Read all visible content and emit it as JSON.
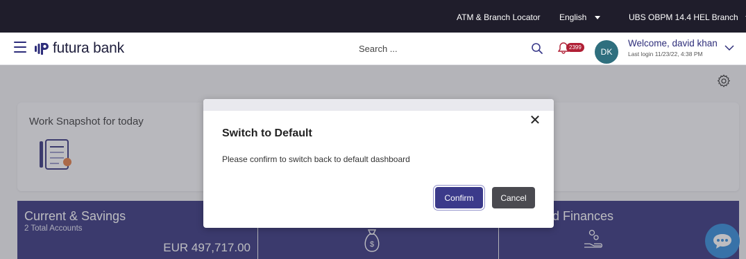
{
  "topbar": {
    "atm_locator": "ATM & Branch Locator",
    "language": "English",
    "branch": "UBS OBPM 14.4 HEL Branch"
  },
  "header": {
    "brand": "futura bank",
    "search_placeholder": "Search ...",
    "notification_count": "2399",
    "avatar_initials": "DK",
    "welcome": "Welcome, david khan",
    "last_login": "Last login 11/23/22, 4:38 PM"
  },
  "dashboard": {
    "snapshot_title": "Work Snapshot for today",
    "current_savings": {
      "title": "Current & Savings",
      "subtitle": "2 Total Accounts",
      "amount": "EUR 497,717.00"
    },
    "finances_title": "d Finances"
  },
  "modal": {
    "title": "Switch to Default",
    "message": "Please confirm to switch back to default dashboard",
    "confirm_label": "Confirm",
    "cancel_label": "Cancel",
    "close_glyph": "✕"
  },
  "icons": {
    "menu": "hamburger-menu-icon",
    "search": "search-icon",
    "bell": "bell-icon",
    "chevron": "chevron-down-icon",
    "settings": "gear-icon",
    "chat": "chat-icon"
  },
  "colors": {
    "topbar": "#1f1d2b",
    "brand": "#2d2d7a",
    "panel": "#2f2e7a",
    "confirm": "#3b3a8a",
    "cancel": "#4a4a50",
    "badge": "#b01f35",
    "chat": "#2b88d8"
  }
}
